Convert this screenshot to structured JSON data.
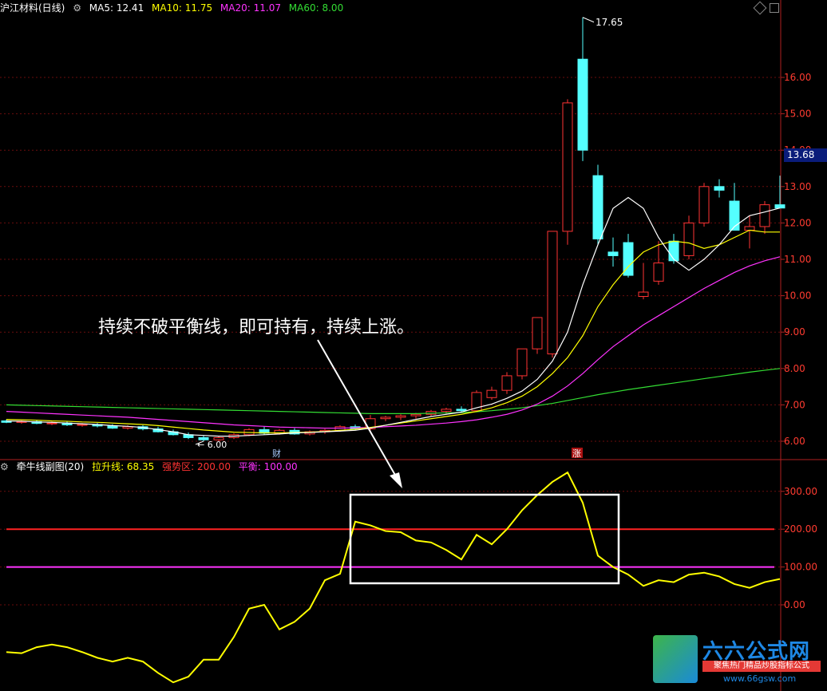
{
  "main_header": {
    "symbol_label": "沪江材料(日线)",
    "ma5": "MA5: 12.41",
    "ma10": "MA10: 11.75",
    "ma20": "MA20: 11.07",
    "ma60": "MA60: 8.00",
    "colors": {
      "ma5": "#ffffff",
      "ma10": "#ffff00",
      "ma20": "#ff33ff",
      "ma60": "#33dd33"
    }
  },
  "sub_header": {
    "indicator_name": "牵牛线副图(20)",
    "line1": "拉升线: 68.35",
    "line2": "强势区: 200.00",
    "line3": "平衡: 100.00",
    "colors": {
      "line1": "#ffff00",
      "line2": "#ff3333",
      "line3": "#ff33ff"
    }
  },
  "current_price": "13.68",
  "annotation": "持续不破平衡线，即可持有，持续上涨。",
  "markers": {
    "high": "17.65",
    "low": "6.00",
    "event1": "财",
    "event2": "涨"
  },
  "logo": {
    "title": "六六公式网",
    "subtitle": "聚焦热门精品炒股指标公式",
    "url": "www.66gsw.com"
  },
  "chart_data": [
    {
      "type": "candlestick",
      "title": "沪江材料(日线)",
      "ylim": [
        5.5,
        18.2
      ],
      "yticks": [
        "16.00",
        "15.00",
        "14.00",
        "13.00",
        "12.00",
        "11.00",
        "10.00",
        "9.00",
        "8.00",
        "7.00",
        "6.00"
      ],
      "candles": [
        {
          "o": 6.56,
          "h": 6.6,
          "l": 6.5,
          "c": 6.52
        },
        {
          "o": 6.52,
          "h": 6.57,
          "l": 6.48,
          "c": 6.54
        },
        {
          "o": 6.54,
          "h": 6.58,
          "l": 6.47,
          "c": 6.49
        },
        {
          "o": 6.49,
          "h": 6.54,
          "l": 6.44,
          "c": 6.5
        },
        {
          "o": 6.5,
          "h": 6.54,
          "l": 6.42,
          "c": 6.45
        },
        {
          "o": 6.45,
          "h": 6.5,
          "l": 6.4,
          "c": 6.46
        },
        {
          "o": 6.46,
          "h": 6.5,
          "l": 6.38,
          "c": 6.42
        },
        {
          "o": 6.42,
          "h": 6.47,
          "l": 6.34,
          "c": 6.36
        },
        {
          "o": 6.36,
          "h": 6.44,
          "l": 6.32,
          "c": 6.4
        },
        {
          "o": 6.4,
          "h": 6.44,
          "l": 6.3,
          "c": 6.34
        },
        {
          "o": 6.34,
          "h": 6.4,
          "l": 6.24,
          "c": 6.26
        },
        {
          "o": 6.26,
          "h": 6.32,
          "l": 6.16,
          "c": 6.18
        },
        {
          "o": 6.18,
          "h": 6.24,
          "l": 6.06,
          "c": 6.1
        },
        {
          "o": 6.1,
          "h": 6.16,
          "l": 6.0,
          "c": 6.04
        },
        {
          "o": 6.04,
          "h": 6.14,
          "l": 6.0,
          "c": 6.1
        },
        {
          "o": 6.1,
          "h": 6.22,
          "l": 6.06,
          "c": 6.18
        },
        {
          "o": 6.18,
          "h": 6.36,
          "l": 6.14,
          "c": 6.32
        },
        {
          "o": 6.32,
          "h": 6.4,
          "l": 6.18,
          "c": 6.22
        },
        {
          "o": 6.22,
          "h": 6.34,
          "l": 6.18,
          "c": 6.3
        },
        {
          "o": 6.3,
          "h": 6.36,
          "l": 6.18,
          "c": 6.2
        },
        {
          "o": 6.2,
          "h": 6.3,
          "l": 6.16,
          "c": 6.26
        },
        {
          "o": 6.26,
          "h": 6.34,
          "l": 6.2,
          "c": 6.3
        },
        {
          "o": 6.3,
          "h": 6.44,
          "l": 6.26,
          "c": 6.4
        },
        {
          "o": 6.4,
          "h": 6.46,
          "l": 6.3,
          "c": 6.34
        },
        {
          "o": 6.34,
          "h": 6.72,
          "l": 6.3,
          "c": 6.62
        },
        {
          "o": 6.62,
          "h": 6.7,
          "l": 6.55,
          "c": 6.66
        },
        {
          "o": 6.66,
          "h": 6.74,
          "l": 6.58,
          "c": 6.7
        },
        {
          "o": 6.7,
          "h": 6.78,
          "l": 6.62,
          "c": 6.74
        },
        {
          "o": 6.74,
          "h": 6.86,
          "l": 6.68,
          "c": 6.82
        },
        {
          "o": 6.82,
          "h": 6.92,
          "l": 6.76,
          "c": 6.88
        },
        {
          "o": 6.88,
          "h": 6.96,
          "l": 6.8,
          "c": 6.84
        },
        {
          "o": 6.84,
          "h": 7.4,
          "l": 6.8,
          "c": 7.34
        },
        {
          "o": 7.2,
          "h": 7.5,
          "l": 7.14,
          "c": 7.4
        },
        {
          "o": 7.4,
          "h": 7.9,
          "l": 7.3,
          "c": 7.8
        },
        {
          "o": 7.8,
          "h": 8.54,
          "l": 7.7,
          "c": 8.54
        },
        {
          "o": 8.54,
          "h": 9.4,
          "l": 8.4,
          "c": 9.4
        },
        {
          "o": 8.4,
          "h": 11.77,
          "l": 8.3,
          "c": 11.77
        },
        {
          "o": 11.77,
          "h": 15.4,
          "l": 11.4,
          "c": 15.3
        },
        {
          "o": 16.5,
          "h": 17.65,
          "l": 13.7,
          "c": 14.0
        },
        {
          "o": 13.3,
          "h": 13.6,
          "l": 11.4,
          "c": 11.56
        },
        {
          "o": 11.2,
          "h": 11.6,
          "l": 10.8,
          "c": 11.1
        },
        {
          "o": 11.46,
          "h": 11.7,
          "l": 10.5,
          "c": 10.56
        },
        {
          "o": 9.98,
          "h": 10.9,
          "l": 9.9,
          "c": 10.1
        },
        {
          "o": 10.4,
          "h": 11.5,
          "l": 10.3,
          "c": 10.9
        },
        {
          "o": 11.5,
          "h": 11.7,
          "l": 10.88,
          "c": 10.96
        },
        {
          "o": 11.1,
          "h": 12.2,
          "l": 11.0,
          "c": 12.0
        },
        {
          "o": 12.0,
          "h": 13.1,
          "l": 11.9,
          "c": 13.0
        },
        {
          "o": 13.0,
          "h": 13.2,
          "l": 12.7,
          "c": 12.9
        },
        {
          "o": 12.6,
          "h": 13.1,
          "l": 12.0,
          "c": 11.8
        },
        {
          "o": 11.8,
          "h": 12.2,
          "l": 11.3,
          "c": 11.9
        },
        {
          "o": 11.9,
          "h": 12.6,
          "l": 11.7,
          "c": 12.5
        },
        {
          "o": 12.5,
          "h": 13.3,
          "l": 12.4,
          "c": 12.41
        }
      ],
      "ma5": [
        6.56,
        6.55,
        6.53,
        6.52,
        6.5,
        6.48,
        6.46,
        6.43,
        6.41,
        6.38,
        6.32,
        6.26,
        6.18,
        6.16,
        6.14,
        6.14,
        6.16,
        6.18,
        6.2,
        6.23,
        6.24,
        6.26,
        6.28,
        6.3,
        6.36,
        6.44,
        6.52,
        6.6,
        6.68,
        6.74,
        6.8,
        6.92,
        7.02,
        7.18,
        7.38,
        7.7,
        8.2,
        9.0,
        10.3,
        11.4,
        12.4,
        12.7,
        12.4,
        11.6,
        11.0,
        10.7,
        11.0,
        11.4,
        11.9,
        12.2,
        12.3,
        12.41
      ],
      "ma10": [
        6.6,
        6.59,
        6.58,
        6.56,
        6.55,
        6.53,
        6.52,
        6.5,
        6.48,
        6.46,
        6.43,
        6.39,
        6.35,
        6.31,
        6.28,
        6.25,
        6.24,
        6.23,
        6.23,
        6.24,
        6.25,
        6.27,
        6.3,
        6.33,
        6.38,
        6.44,
        6.5,
        6.56,
        6.62,
        6.68,
        6.74,
        6.82,
        6.92,
        7.06,
        7.24,
        7.5,
        7.86,
        8.3,
        8.9,
        9.7,
        10.3,
        10.8,
        11.2,
        11.4,
        11.5,
        11.45,
        11.3,
        11.4,
        11.6,
        11.8,
        11.75,
        11.75
      ],
      "ma20": [
        6.82,
        6.8,
        6.78,
        6.76,
        6.74,
        6.72,
        6.7,
        6.68,
        6.66,
        6.63,
        6.6,
        6.57,
        6.54,
        6.51,
        6.48,
        6.45,
        6.43,
        6.41,
        6.39,
        6.38,
        6.37,
        6.36,
        6.36,
        6.37,
        6.38,
        6.4,
        6.42,
        6.44,
        6.47,
        6.5,
        6.54,
        6.59,
        6.66,
        6.74,
        6.86,
        7.02,
        7.24,
        7.52,
        7.86,
        8.24,
        8.6,
        8.9,
        9.2,
        9.45,
        9.7,
        9.95,
        10.2,
        10.42,
        10.64,
        10.82,
        10.96,
        11.07
      ],
      "ma60": [
        7.0,
        6.99,
        6.98,
        6.97,
        6.96,
        6.95,
        6.94,
        6.93,
        6.92,
        6.91,
        6.9,
        6.89,
        6.88,
        6.87,
        6.86,
        6.85,
        6.84,
        6.83,
        6.82,
        6.81,
        6.8,
        6.79,
        6.78,
        6.77,
        6.76,
        6.76,
        6.76,
        6.76,
        6.77,
        6.78,
        6.79,
        6.81,
        6.84,
        6.88,
        6.92,
        6.98,
        7.04,
        7.12,
        7.2,
        7.28,
        7.35,
        7.42,
        7.48,
        7.54,
        7.6,
        7.66,
        7.72,
        7.78,
        7.84,
        7.9,
        7.95,
        8.0
      ]
    },
    {
      "type": "line",
      "title": "牵牛线副图(20)",
      "ylim": [
        -220,
        370
      ],
      "yticks": [
        "300.00",
        "200.00",
        "100.00",
        "0.00"
      ],
      "reference_lines": [
        {
          "name": "强势区",
          "value": 200
        },
        {
          "name": "平衡",
          "value": 100
        }
      ],
      "series": [
        {
          "name": "拉升线",
          "values": [
            -125,
            -128,
            -112,
            -105,
            -112,
            -125,
            -140,
            -150,
            -140,
            -150,
            -180,
            -205,
            -190,
            -145,
            -145,
            -85,
            -10,
            0,
            -65,
            -45,
            -10,
            65,
            82,
            220,
            210,
            195,
            192,
            170,
            165,
            145,
            120,
            185,
            160,
            200,
            250,
            290,
            325,
            350,
            270,
            130,
            100,
            80,
            50,
            65,
            60,
            80,
            85,
            75,
            55,
            45,
            60,
            68.35
          ]
        }
      ]
    }
  ]
}
